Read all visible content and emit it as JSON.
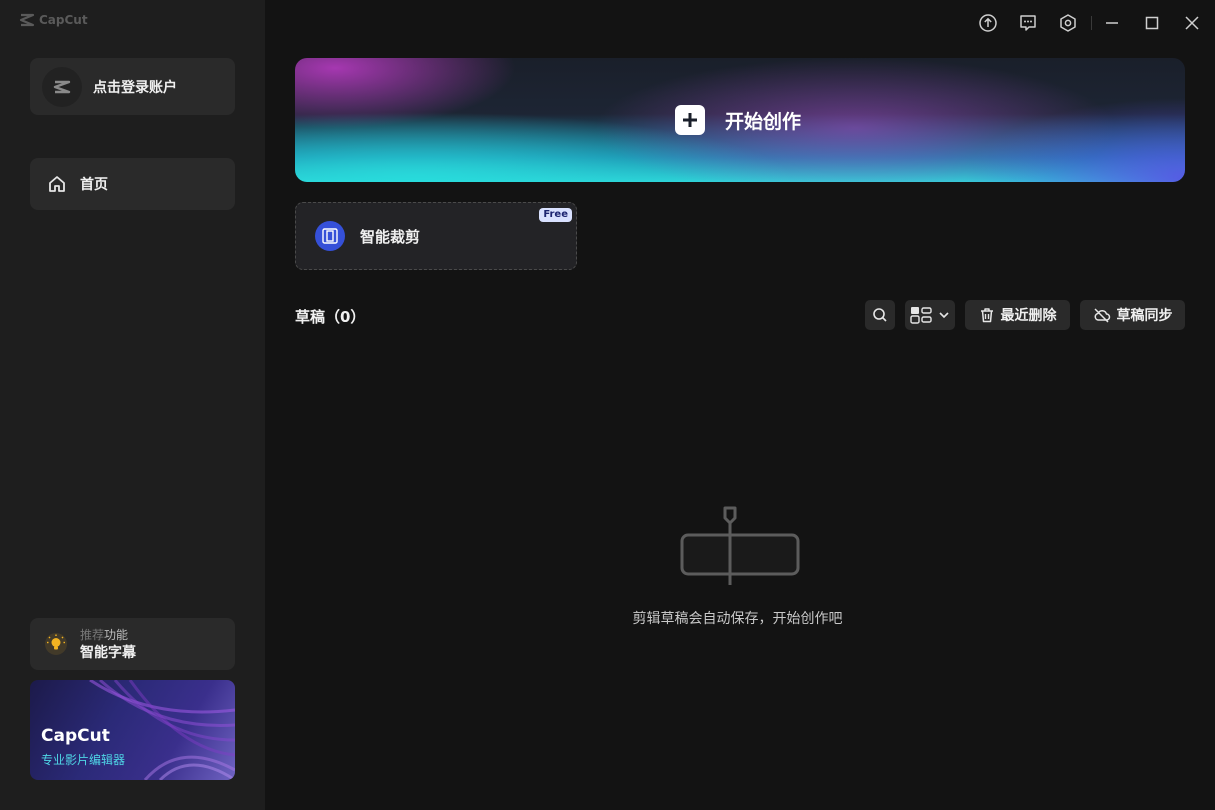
{
  "app": {
    "logo_text": "CapCut"
  },
  "sidebar": {
    "login_label": "点击登录账户",
    "nav_home_label": "首页",
    "feature": {
      "sub_dim": "推荐",
      "sub_rest": "功能",
      "title": "智能字幕"
    },
    "promo": {
      "title": "CapCut",
      "subtitle": "专业影片编辑器"
    }
  },
  "main": {
    "hero_label": "开始创作",
    "tool_card": {
      "label": "智能裁剪",
      "badge": "Free"
    },
    "drafts": {
      "title": "草稿（0）",
      "recent_delete_label": "最近删除",
      "sync_label": "草稿同步",
      "empty_message": "剪辑草稿会自动保存，开始创作吧"
    }
  },
  "icons": {
    "upload": "upload-icon",
    "feedback": "feedback-icon",
    "settings": "settings-icon",
    "minimize": "minimize-icon",
    "maximize": "maximize-icon",
    "close": "close-icon"
  },
  "colors": {
    "sidebar_bg": "#1e1e1e",
    "main_bg": "#131313",
    "card_bg": "#2a2a2a",
    "accent_blue": "#3550d8",
    "promo_accent": "#4fd6e6"
  }
}
